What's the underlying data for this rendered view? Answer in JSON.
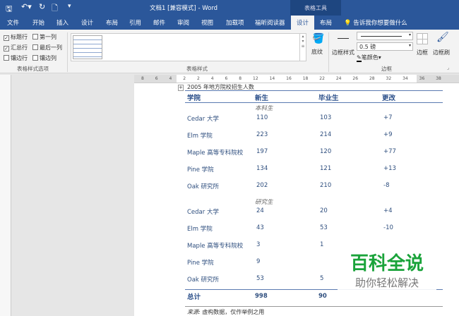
{
  "titlebar": {
    "title": "文档1 [兼容模式] - Word",
    "table_tools": "表格工具"
  },
  "tabs": [
    "文件",
    "开始",
    "插入",
    "设计",
    "布局",
    "引用",
    "邮件",
    "审阅",
    "视图",
    "加载项",
    "福昕阅读器",
    "设计",
    "布局"
  ],
  "tell_me": "告诉我你想要做什么",
  "ribbon": {
    "options": [
      {
        "label": "标题行",
        "checked": true
      },
      {
        "label": "第一列",
        "checked": false
      },
      {
        "label": "汇总行",
        "checked": true
      },
      {
        "label": "最后一列",
        "checked": false
      },
      {
        "label": "镶边行",
        "checked": false
      },
      {
        "label": "镶边列",
        "checked": false
      }
    ],
    "group_options": "表格样式选项",
    "group_styles": "表格样式",
    "shading": "底纹",
    "border_styles": "边框样式",
    "pen_weight": "0.5 磅",
    "pen_color": "笔颜色",
    "borders": "边框",
    "border_painter": "边框刷",
    "group_borders": "边框"
  },
  "ruler": [
    "8",
    "6",
    "4",
    "2",
    "2",
    "4",
    "6",
    "8",
    "12",
    "14",
    "16",
    "18",
    "22",
    "24",
    "26",
    "28",
    "32",
    "34",
    "36",
    "38"
  ],
  "document": {
    "caption": "2005 年地方院校招生人数",
    "headers": [
      "学院",
      "新生",
      "毕业生",
      "更改"
    ],
    "section1": "本科生",
    "rows1": [
      [
        "Cedar 大学",
        "110",
        "103",
        "+7"
      ],
      [
        "Elm 学院",
        "223",
        "214",
        "+9"
      ],
      [
        "Maple 高等专科院校",
        "197",
        "120",
        "+77"
      ],
      [
        "Pine 学院",
        "134",
        "121",
        "+13"
      ],
      [
        "Oak 研究所",
        "202",
        "210",
        "-8"
      ]
    ],
    "section2": "研究生",
    "rows2": [
      [
        "Cedar 大学",
        "24",
        "20",
        "+4"
      ],
      [
        "Elm 学院",
        "43",
        "53",
        "-10"
      ],
      [
        "Maple 高等专科院校",
        "3",
        "1",
        ""
      ],
      [
        "Pine 学院",
        "9",
        "",
        ""
      ],
      [
        "Oak 研究所",
        "53",
        "5",
        ""
      ]
    ],
    "total": [
      "总计",
      "998",
      "90"
    ],
    "source_label": "来源:",
    "source_text": "虚构数据，仅作举例之用"
  },
  "watermark": {
    "title": "百科全说",
    "subtitle": "助你轻松解决"
  }
}
